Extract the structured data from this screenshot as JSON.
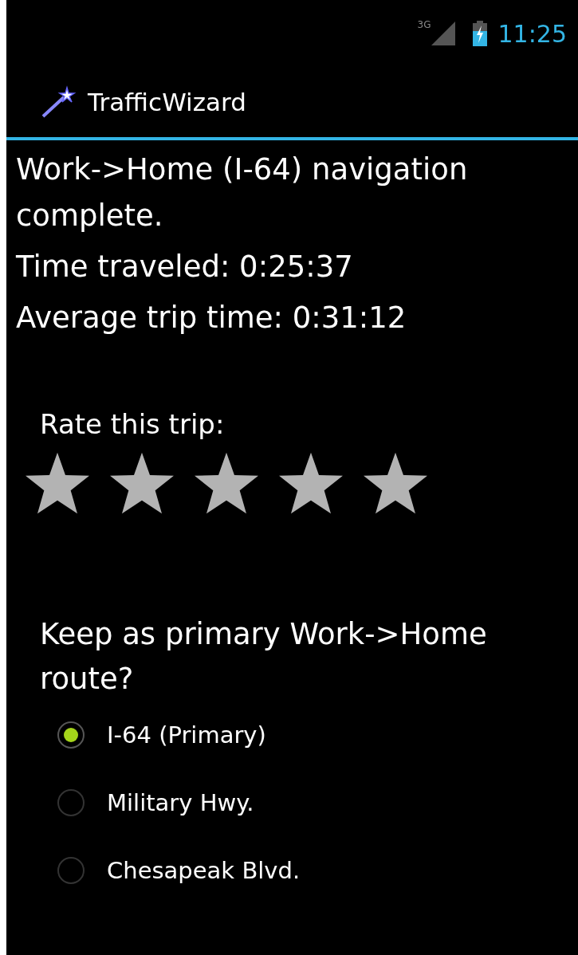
{
  "status_bar": {
    "network": "3G",
    "time": "11:25"
  },
  "action_bar": {
    "title": "TrafficWizard"
  },
  "summary": [
    "Work->Home (I-64) navigation complete.",
    "Time traveled: 0:25:37",
    "Average trip time: 0:31:12"
  ],
  "rating": {
    "label": "Rate this trip:",
    "stars": 5
  },
  "route_question": "Keep as primary Work->Home route?",
  "routes": [
    {
      "label": "I-64 (Primary)",
      "selected": true
    },
    {
      "label": "Military Hwy.",
      "selected": false
    },
    {
      "label": "Chesapeak Blvd.",
      "selected": false
    }
  ]
}
